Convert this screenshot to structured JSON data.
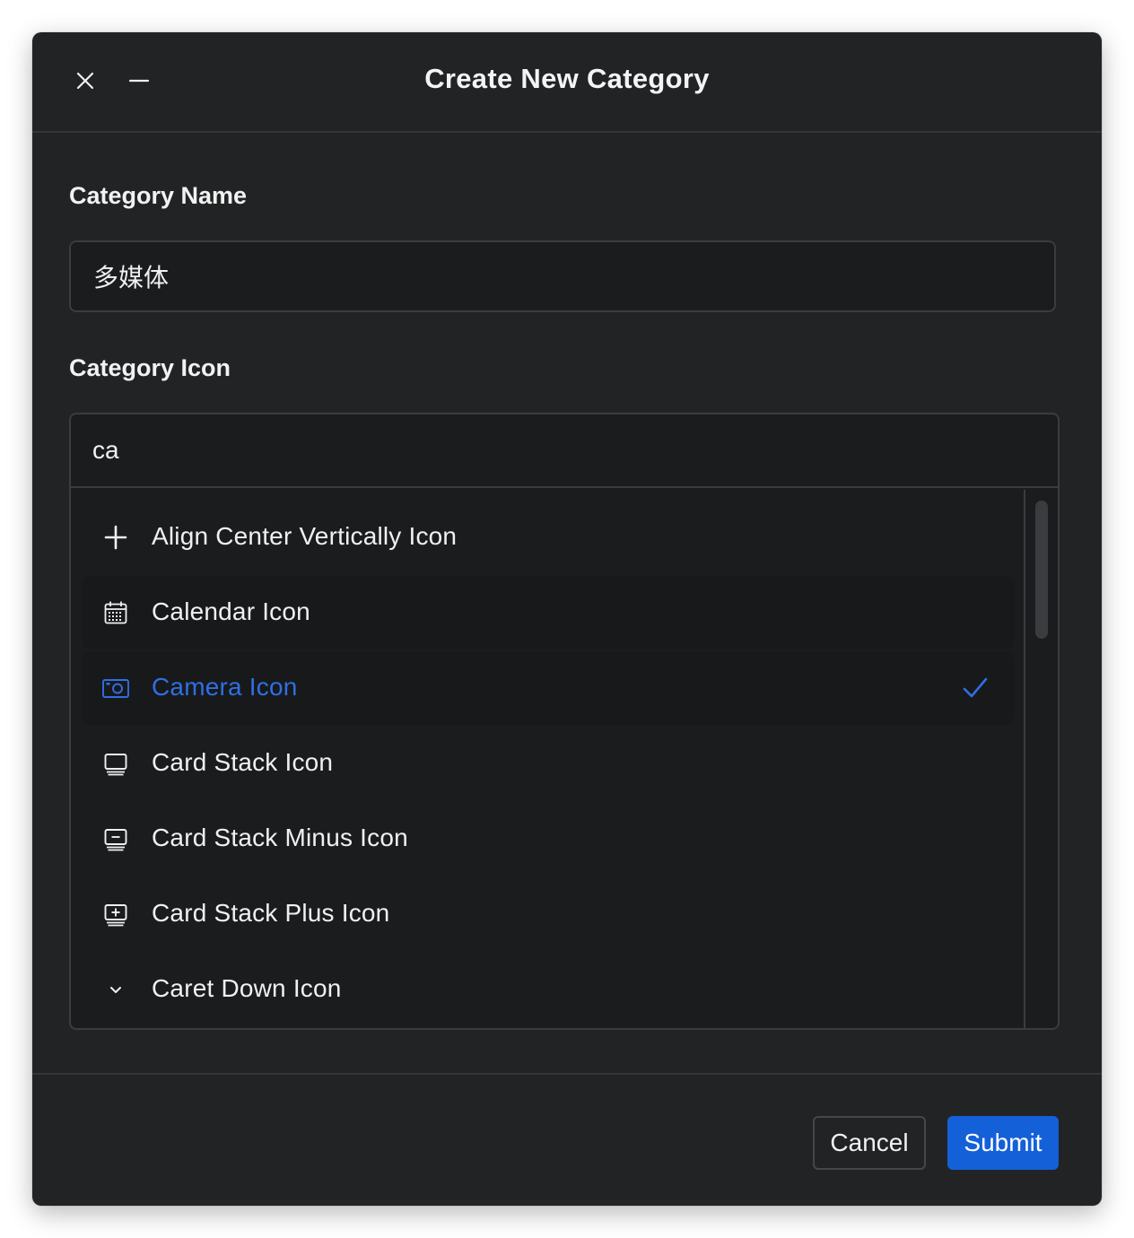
{
  "dialog": {
    "title": "Create New Category",
    "close_icon": "close-icon",
    "minimize_icon": "minimize-icon"
  },
  "form": {
    "name_label": "Category Name",
    "name_value": "多媒体",
    "icon_label": "Category Icon",
    "icon_search_value": "ca"
  },
  "icon_list": {
    "items": [
      {
        "label": "Align Center Vertically Icon",
        "icon": "align-center-vertically-icon",
        "state": "normal"
      },
      {
        "label": "Calendar Icon",
        "icon": "calendar-icon",
        "state": "hover"
      },
      {
        "label": "Camera Icon",
        "icon": "camera-icon",
        "state": "selected"
      },
      {
        "label": "Card Stack Icon",
        "icon": "card-stack-icon",
        "state": "normal"
      },
      {
        "label": "Card Stack Minus Icon",
        "icon": "card-stack-minus-icon",
        "state": "normal"
      },
      {
        "label": "Card Stack Plus Icon",
        "icon": "card-stack-plus-icon",
        "state": "normal"
      },
      {
        "label": "Caret Down Icon",
        "icon": "caret-down-icon",
        "state": "normal"
      }
    ],
    "selected_check_icon": "check-icon"
  },
  "footer": {
    "cancel_label": "Cancel",
    "submit_label": "Submit"
  },
  "colors": {
    "dialog_bg": "#222325",
    "input_bg": "#1b1c1e",
    "border": "#3a3c40",
    "accent": "#1460d9",
    "selected_text": "#2f6fe4",
    "text": "#f2f2f2"
  }
}
